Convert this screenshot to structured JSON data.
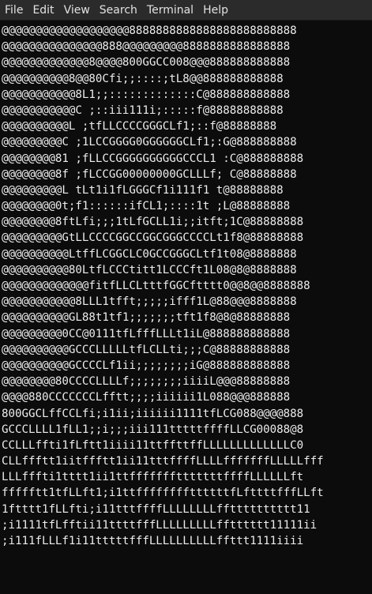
{
  "menu": [
    {
      "id": "file",
      "label": "File"
    },
    {
      "id": "edit",
      "label": "Edit"
    },
    {
      "id": "view",
      "label": "View"
    },
    {
      "id": "search",
      "label": "Search"
    },
    {
      "id": "terminal",
      "label": "Terminal"
    },
    {
      "id": "help",
      "label": "Help"
    }
  ],
  "terminal": {
    "lines": [
      "@@@@@@@@@@@@@@@@@@@8888888888888888888888888",
      "@@@@@@@@@@@@@@@888@@@@@@@@@8888888888888888",
      "@@@@@@@@@@@@@8@@@@800GGCC008@@@888888888888",
      "@@@@@@@@@@8@@80Cfi;;::::;tL8@@888888888888",
      "@@@@@@@@@@@8L1;;:::::::::::::C@888888888888",
      "@@@@@@@@@@@C ;::iii111i;:::::f@88888888888",
      "@@@@@@@@@@L ;tfLLCCCCGGGCLf1;::f@88888888",
      "@@@@@@@@@C ;1LCCGGGG0GGGGGGCLf1;:G@888888888",
      "@@@@@@@@81 ;fLLCCGGGGGGGGGGCCCL1 :C@888888888",
      "@@@@@@@@8f ;fLCCGG00000000GCLLLf; C@88888888",
      "@@@@@@@@@L tLt1i1fLGGGCf1i111f1 t@88888888",
      "@@@@@@@@0t;f1::::::ifCL1;::::1t ;L@88888888",
      "@@@@@@@@8ftLfi;;;1tLfGCLL1i;;itft;1C@88888888",
      "@@@@@@@@@GtLLCCCCGGCCGGCGGGCCCCLt1f8@88888888",
      "@@@@@@@@@@LtffLCGGCLC0GCCGGGCLtf1t08@8888888",
      "@@@@@@@@@@80LtfLCCCtitt1LCCCft1L08@8@8888888",
      "@@@@@@@@@@@@@fitfLLCLtttfGGCftttt0@@8@@8888888",
      "@@@@@@@@@@@8LLL1tfft;;;;;ifff1L@88@@@8888888",
      "@@@@@@@@@@GL88t1tf1;;;;;;;tft1f8@8@88888888",
      "@@@@@@@@@0CC@0111tfLfffLLLt1iL@888888888888",
      "@@@@@@@@@@GCCCLLLLLtfLCLLti;;;C@88888888888",
      "@@@@@@@@@@GCCCCLf1ii;;;;;;;;iG@888888888888",
      "@@@@@@@@80CCCCLLLLf;;;;;;;;iiiiL@@@88888888",
      "@@@@880CCCCCCCLfftt;;;;iiiiii1L088@@@888888",
      "800GGCLffCCLfi;i1ii;iiiiii1111tfLCG088@@@@888",
      "GCCCLLLL1fLL1;;i;;;iii111tttttffffLLCG00088@8",
      "CCLLLffti1fLftt1iiii11ttffttffLLLLLLLLLLLLLC0",
      "CLLffftt1iitffftt1ii11tttffffLLLLfffffffLLLLLfff",
      "LLLfffti1tttt1ii1ttffffffftttttttffffLLLLLLft",
      "ffffftt1tfLLft1;i1ttffffffffttttttfLfttttfffLLft",
      "1ftttt1fLLfti;i11tttffffLLLLLLLLfftttttttttt11",
      ";i1111tfLfftii11ttttfffLLLLLLLLLfftttttt11111ii",
      ";i111fLLLf1i11tttttfffLLLLLLLLLLffttt1111iiii"
    ]
  },
  "colors": {
    "menubar_bg": "#2b2b2b",
    "terminal_bg": "#0c0c0c",
    "text": "#ececec"
  }
}
